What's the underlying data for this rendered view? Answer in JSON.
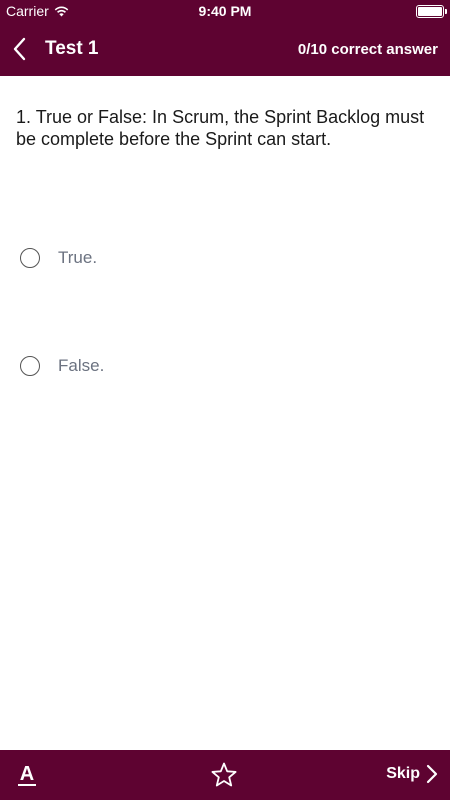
{
  "status_bar": {
    "carrier": "Carrier",
    "time": "9:40 PM"
  },
  "nav": {
    "title": "Test 1",
    "score": "0/10 correct answer",
    "back_icon": "chevron-left-icon"
  },
  "question": {
    "text": "1. True or False: In Scrum, the Sprint Backlog must be complete before the Sprint can start."
  },
  "options": [
    {
      "label": "True.",
      "selected": false
    },
    {
      "label": "False.",
      "selected": false
    }
  ],
  "toolbar": {
    "font_icon": "font-size-icon",
    "font_letter": "A",
    "favorite_icon": "star-icon",
    "skip_label": "Skip"
  },
  "colors": {
    "brand": "#5e0331",
    "option_text": "#6b7280",
    "background": "#ffffff"
  }
}
